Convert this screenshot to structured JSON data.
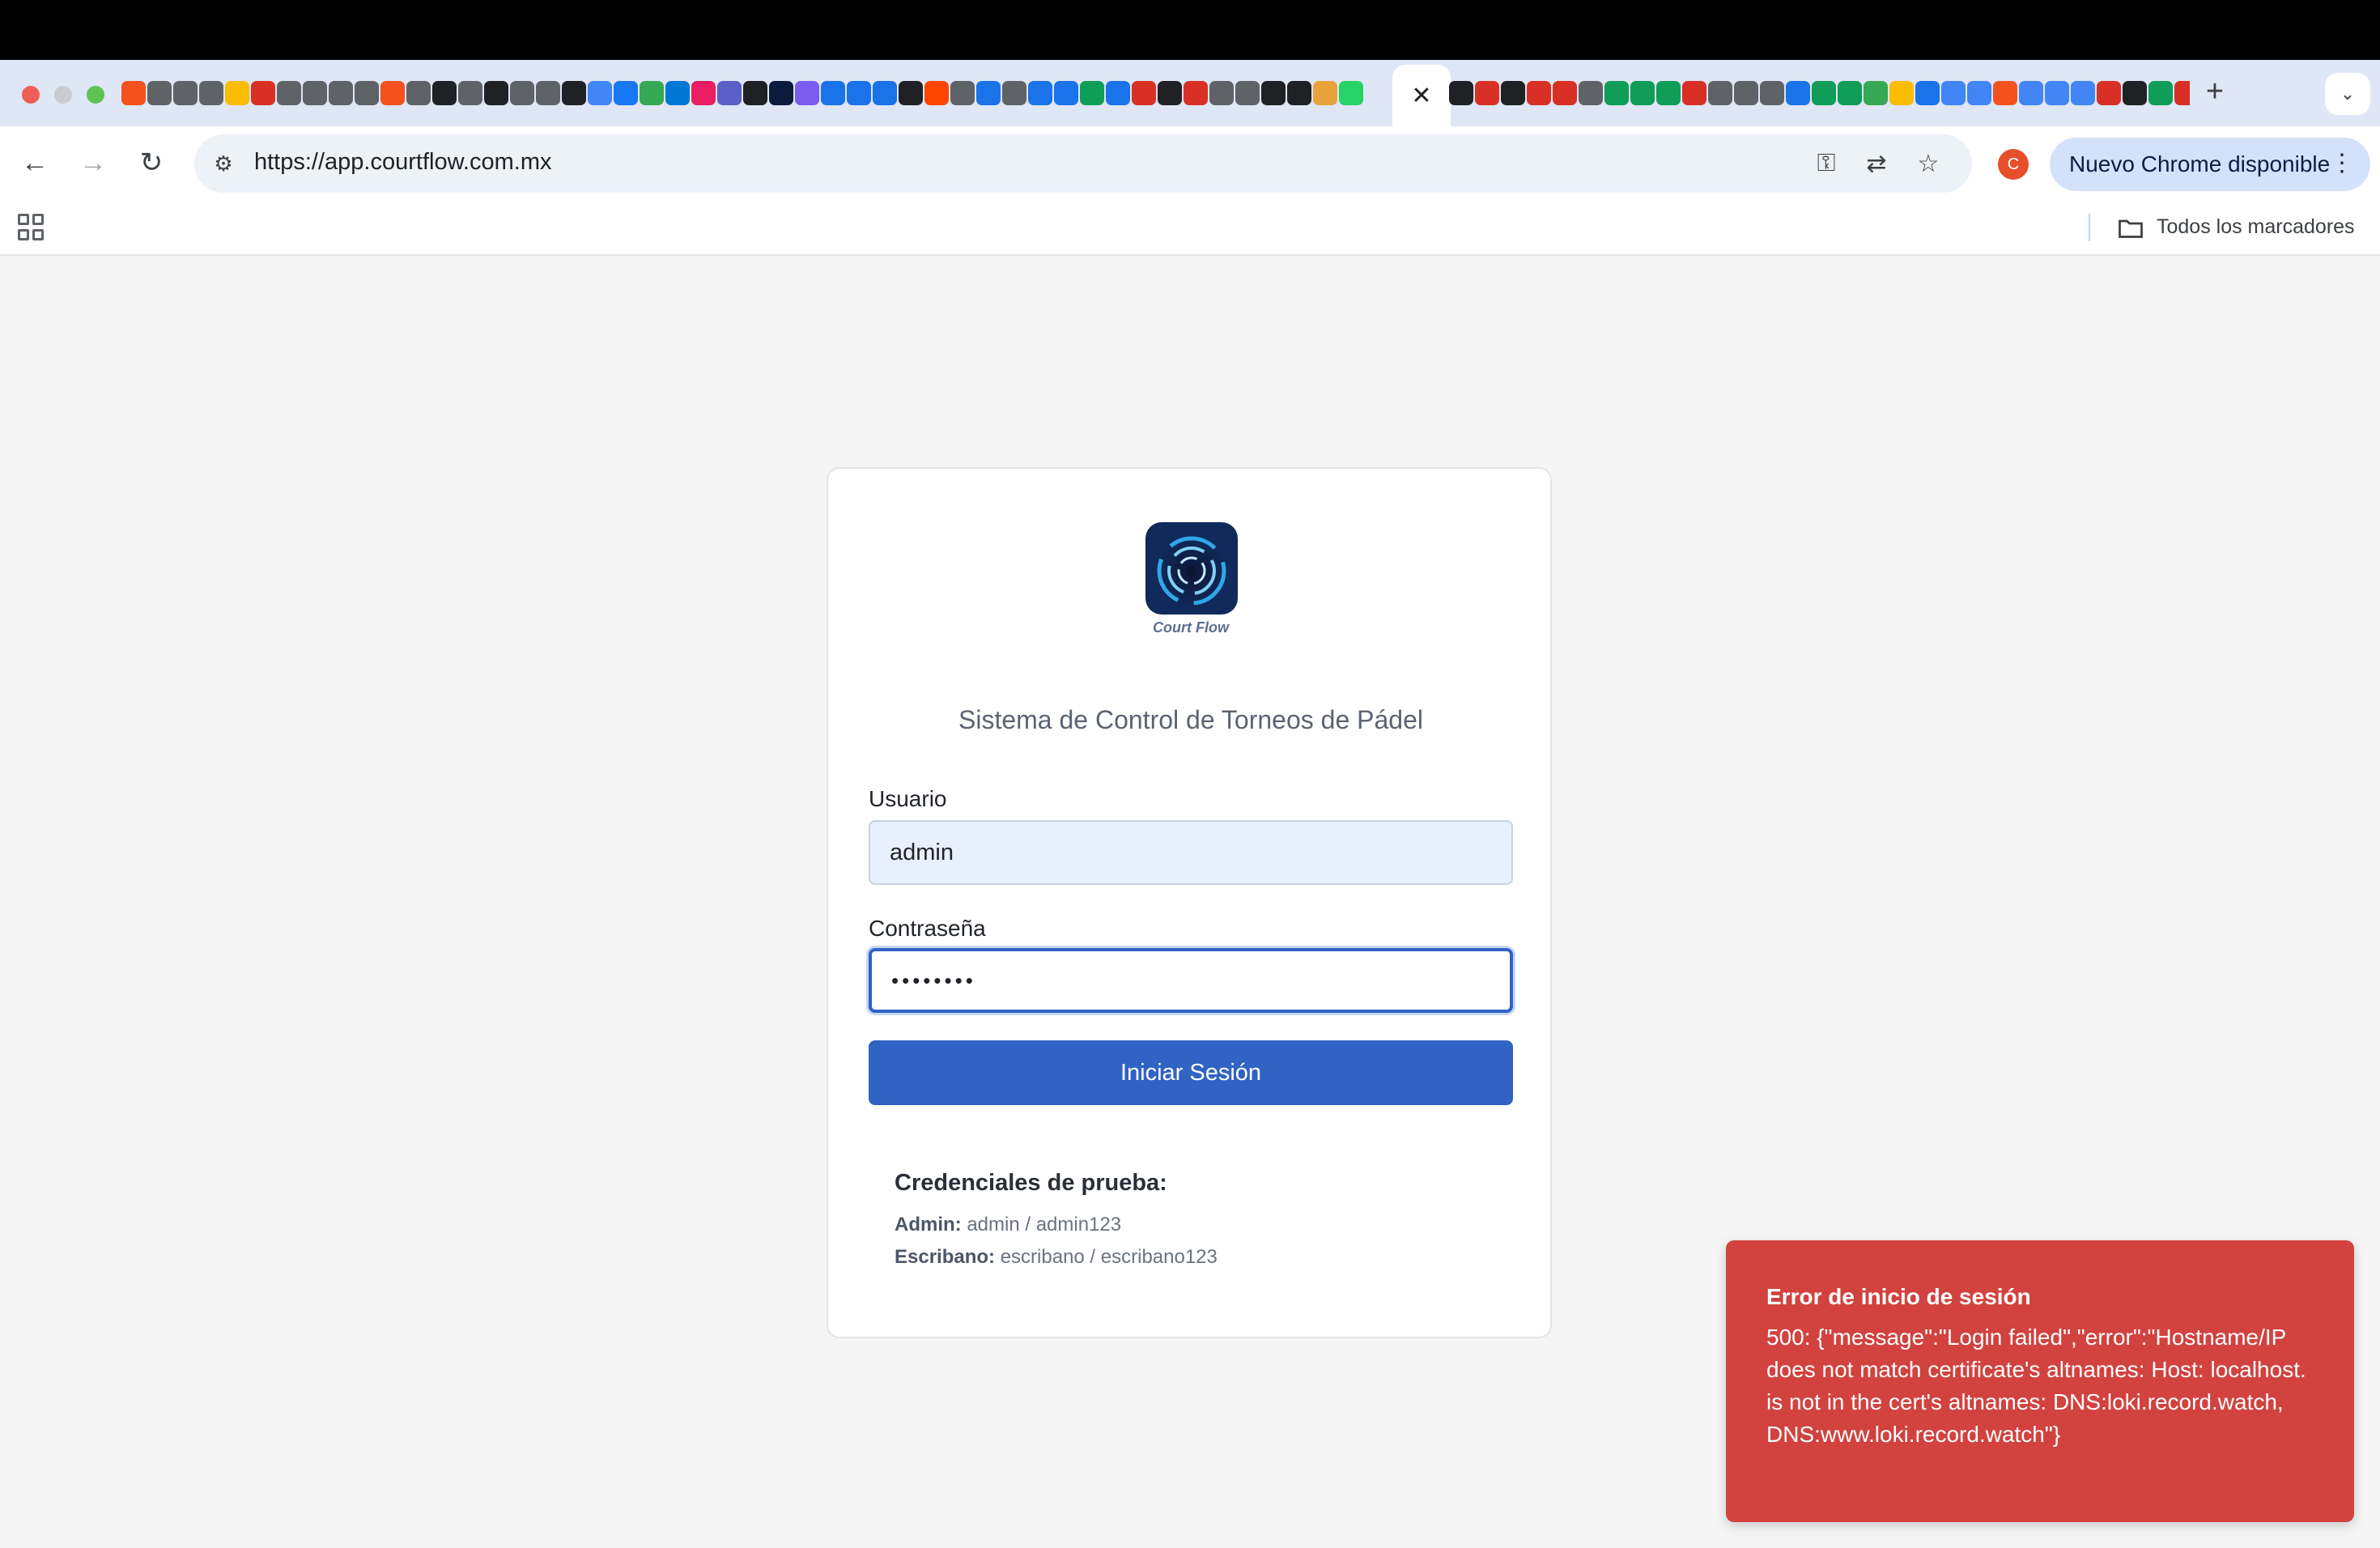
{
  "browser": {
    "url": "https://app.courtflow.com.mx",
    "update_chip": "Nuevo Chrome disponible",
    "profile_initial": "C",
    "bookmarks_label": "Todos los marcadores",
    "favicon_colors_left": [
      "#f4511e",
      "#5f6368",
      "#5f6368",
      "#5f6368",
      "#fbbc04",
      "#d93025",
      "#5f6368",
      "#5f6368",
      "#5f6368",
      "#5f6368",
      "#f4511e",
      "#5f6368",
      "#202124",
      "#5f6368",
      "#202124",
      "#5f6368",
      "#5f6368",
      "#202124",
      "#4285f4",
      "#1877f2",
      "#34a853",
      "#0078d4",
      "#e91e63",
      "#5b5fc7",
      "#202124",
      "#0b1b3f",
      "#7b5cf0",
      "#1a73e8",
      "#1a73e8",
      "#1a73e8",
      "#202124",
      "#ff4500",
      "#5f6368",
      "#1a73e8",
      "#5f6368",
      "#1a73e8",
      "#1a73e8",
      "#0f9d58",
      "#1a73e8",
      "#d93025",
      "#202124",
      "#d93025",
      "#5f6368",
      "#5f6368",
      "#202124",
      "#202124",
      "#e8a33d",
      "#25d366"
    ],
    "favicon_colors_right": [
      "#202124",
      "#d93025",
      "#202124",
      "#d93025",
      "#d93025",
      "#5f6368",
      "#0f9d58",
      "#0f9d58",
      "#0f9d58",
      "#d93025",
      "#5f6368",
      "#5f6368",
      "#5f6368",
      "#1a73e8",
      "#0f9d58",
      "#0f9d58",
      "#34a853",
      "#fbbc04",
      "#1a73e8",
      "#4285f4",
      "#4285f4",
      "#f4511e",
      "#4285f4",
      "#4285f4",
      "#4285f4",
      "#d93025",
      "#202124",
      "#0f9d58",
      "#d93025",
      "#5f6368"
    ]
  },
  "login": {
    "logo_text": "Court Flow",
    "subtitle": "Sistema de Control de Torneos de Pádel",
    "username_label": "Usuario",
    "username_value": "admin",
    "password_label": "Contraseña",
    "password_mask": "••••••••",
    "submit_label": "Iniciar Sesión",
    "creds_title": "Credenciales de prueba:",
    "creds": [
      {
        "role": "Admin:",
        "value": "admin / admin123"
      },
      {
        "role": "Escribano:",
        "value": "escribano / escribano123"
      }
    ]
  },
  "toast": {
    "title": "Error de inicio de sesión",
    "message": "500: {\"message\":\"Login failed\",\"error\":\"Hostname/IP does not match certificate's altnames: Host: localhost. is not in the cert's altnames: DNS:loki.record.watch, DNS:www.loki.record.watch\"}",
    "color": "#d2423e"
  }
}
